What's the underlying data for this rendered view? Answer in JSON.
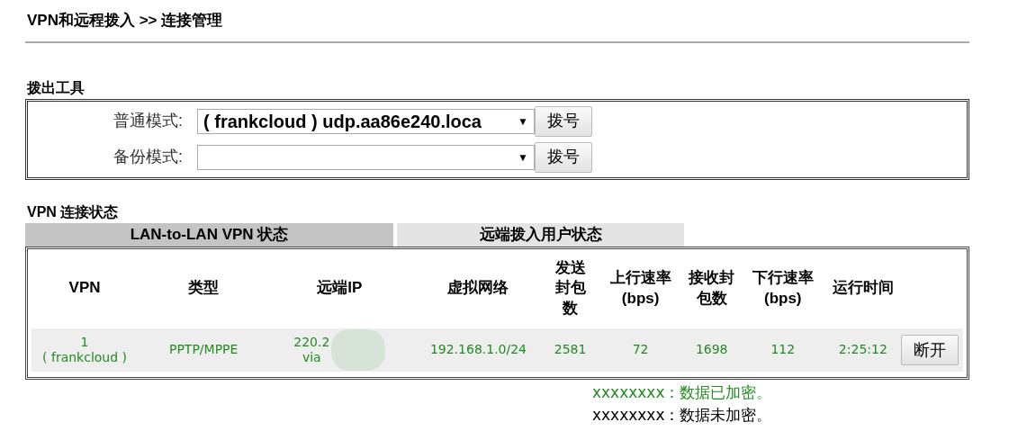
{
  "page_title": "VPN和远程拨入 >> 连接管理",
  "dial_out": {
    "title": "拨出工具",
    "rows": [
      {
        "label": "普通模式:",
        "value": "( frankcloud ) udp.aa86e240.loca",
        "caret": "▼",
        "button": "拨号"
      },
      {
        "label": "备份模式:",
        "value": "",
        "caret": "▼",
        "button": "拨号"
      }
    ]
  },
  "status": {
    "title": "VPN 连接状态",
    "tabs": [
      {
        "label": "LAN-to-LAN VPN 状态",
        "selected": true
      },
      {
        "label": "远端拨入用户状态",
        "selected": false
      }
    ],
    "columns": [
      "VPN",
      "类型",
      "远端IP",
      "虚拟网络",
      "发送封包数",
      "上行速率 (bps)",
      "接收封包数",
      "下行速率 (bps)",
      "运行时间"
    ],
    "rows": [
      {
        "encrypted": true,
        "vpn": [
          "1",
          "( frankcloud )"
        ],
        "type": "PPTP/MPPE",
        "remote_ip": [
          "220.2",
          "via"
        ],
        "network": "192.168.1.0/24",
        "tx_packets": "2581",
        "tx_rate": "72",
        "rx_packets": "1698",
        "rx_rate": "112",
        "uptime": "2:25:12",
        "button": "断开"
      }
    ]
  },
  "legend": [
    {
      "encrypted": true,
      "text": "xxxxxxxx：数据已加密。"
    },
    {
      "encrypted": false,
      "text": "xxxxxxxx：数据未加密。"
    }
  ]
}
